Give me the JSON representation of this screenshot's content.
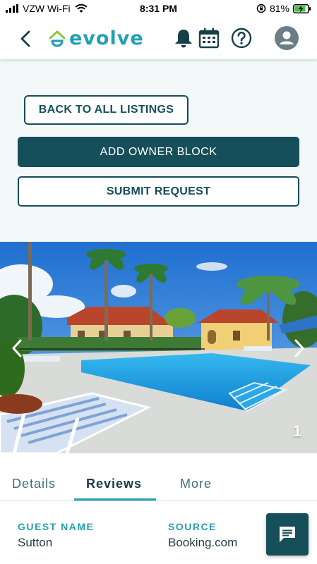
{
  "status_bar": {
    "carrier": "VZW Wi-Fi",
    "time": "8:31 PM",
    "battery": "81%"
  },
  "header": {
    "logo_text": "evolve",
    "icons": [
      "back-arrow-icon",
      "bell-icon",
      "calendar-icon",
      "help-icon",
      "account-icon"
    ]
  },
  "actions": {
    "back_to_listings": "BACK TO ALL LISTINGS",
    "add_owner_block": "ADD OWNER BLOCK",
    "submit_request": "SUBMIT REQUEST"
  },
  "photo": {
    "index": "1"
  },
  "tabs": [
    {
      "label": "Details",
      "active": false
    },
    {
      "label": "Reviews",
      "active": true
    },
    {
      "label": "More",
      "active": false
    }
  ],
  "review": {
    "guest_name_label": "GUEST NAME",
    "guest_name": "Sutton",
    "source_label": "SOURCE",
    "source": "Booking.com"
  },
  "colors": {
    "brand_dark": "#164e5a",
    "brand_accent": "#22a0b5",
    "logo_green": "#8cc63f"
  }
}
